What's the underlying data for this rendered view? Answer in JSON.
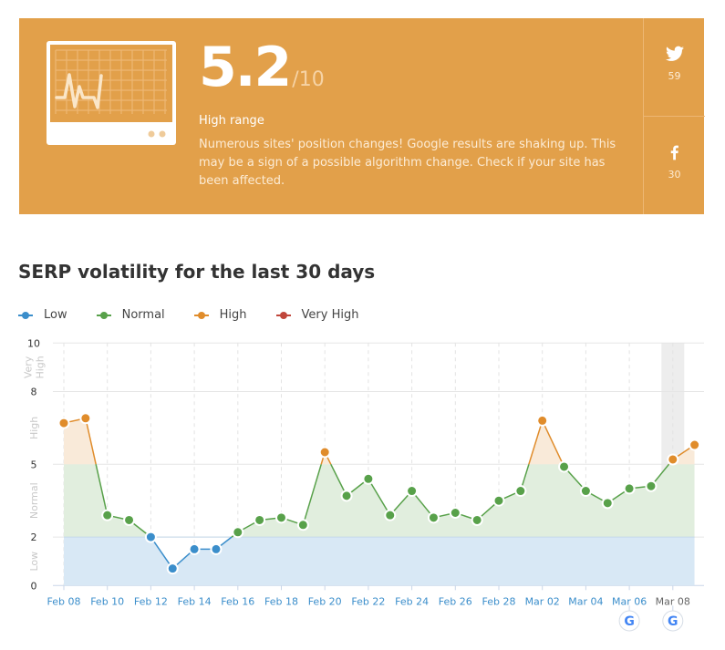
{
  "hero": {
    "score": "5.2",
    "score_max": "/10",
    "range_label": "High range",
    "description": "Numerous sites' position changes! Google results are shaking up. This may be a sign of a possible algorithm change. Check if your site has been affected.",
    "background_color": "#E2A04A",
    "icon": "monitor-heartbeat-icon",
    "social": [
      {
        "network": "twitter",
        "icon": "twitter-icon",
        "count": "59"
      },
      {
        "network": "facebook",
        "icon": "facebook-icon",
        "count": "30"
      }
    ]
  },
  "section_title": "SERP volatility for the last 30 days",
  "legend": [
    {
      "label": "Low",
      "color": "#3B8ECB"
    },
    {
      "label": "Normal",
      "color": "#58A14A"
    },
    {
      "label": "High",
      "color": "#E08C2B"
    },
    {
      "label": "Very High",
      "color": "#C0463B"
    }
  ],
  "chart_data": {
    "type": "line",
    "title": "SERP volatility for the last 30 days",
    "xlabel": "",
    "ylabel": "",
    "ylim": [
      0,
      10
    ],
    "yticks": [
      0,
      2,
      5,
      8,
      10
    ],
    "bands": [
      {
        "label": "Low",
        "from": 0,
        "to": 2,
        "color": "#3B8ECB"
      },
      {
        "label": "Normal",
        "from": 2,
        "to": 5,
        "color": "#58A14A"
      },
      {
        "label": "High",
        "from": 5,
        "to": 8,
        "color": "#E08C2B"
      },
      {
        "label": "Very High",
        "from": 8,
        "to": 10,
        "color": "#C0463B"
      }
    ],
    "band_axis_labels": [
      "Low",
      "Normal",
      "High",
      "Very High"
    ],
    "x": [
      "Feb 08",
      "Feb 09",
      "Feb 10",
      "Feb 11",
      "Feb 12",
      "Feb 13",
      "Feb 14",
      "Feb 15",
      "Feb 16",
      "Feb 17",
      "Feb 18",
      "Feb 19",
      "Feb 20",
      "Feb 21",
      "Feb 22",
      "Feb 23",
      "Feb 24",
      "Feb 25",
      "Feb 26",
      "Feb 27",
      "Feb 28",
      "Mar 01",
      "Mar 02",
      "Mar 03",
      "Mar 04",
      "Mar 05",
      "Mar 06",
      "Mar 07",
      "Mar 08",
      "Mar 09"
    ],
    "xtick_labels": [
      "Feb 08",
      "Feb 10",
      "Feb 12",
      "Feb 14",
      "Feb 16",
      "Feb 18",
      "Feb 20",
      "Feb 22",
      "Feb 24",
      "Feb 26",
      "Feb 28",
      "Mar 02",
      "Mar 04",
      "Mar 06",
      "Mar 08"
    ],
    "series": [
      {
        "name": "SERP volatility",
        "values": [
          6.7,
          6.9,
          2.9,
          2.7,
          2.0,
          0.7,
          1.5,
          1.5,
          2.2,
          2.7,
          2.8,
          2.5,
          5.5,
          3.7,
          4.4,
          2.9,
          3.9,
          2.8,
          3.0,
          2.7,
          3.5,
          3.9,
          6.8,
          4.9,
          3.9,
          3.4,
          4.0,
          4.1,
          5.2,
          5.8
        ]
      }
    ],
    "highlighted_date": "Mar 08",
    "google_update_markers": [
      "Mar 06",
      "Mar 08"
    ],
    "grid": true
  }
}
